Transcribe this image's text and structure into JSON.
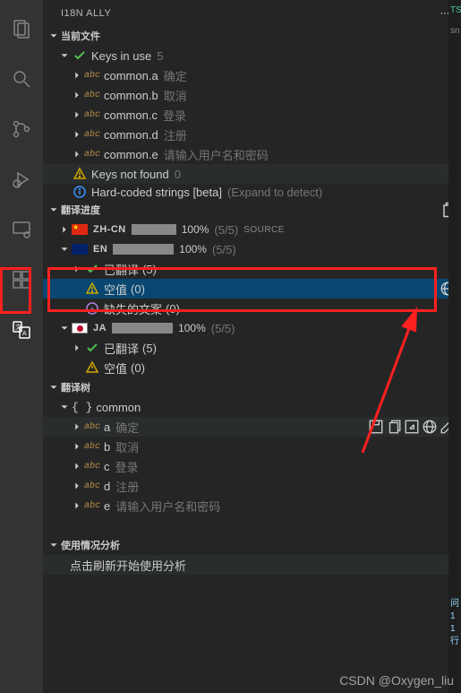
{
  "panel_title": "I18N ALLY",
  "sections": {
    "current_file": {
      "title": "当前文件",
      "keys_in_use": {
        "label": "Keys in use",
        "count": "5"
      },
      "keys": [
        {
          "key": "common.a",
          "hint": "确定"
        },
        {
          "key": "common.b",
          "hint": "取消"
        },
        {
          "key": "common.c",
          "hint": "登录"
        },
        {
          "key": "common.d",
          "hint": "注册"
        },
        {
          "key": "common.e",
          "hint": "请输入用户名和密码"
        }
      ],
      "keys_not_found": {
        "label": "Keys not found",
        "count": "0"
      },
      "hardcoded": {
        "label": "Hard-coded strings [beta]",
        "hint": "(Expand to detect)"
      }
    },
    "progress": {
      "title": "翻译进度",
      "langs": [
        {
          "code": "ZH-CN",
          "flag": "cn",
          "pct": "100%",
          "ratio": "(5/5)",
          "source": "SOURCE",
          "bar": 100
        },
        {
          "code": "EN",
          "flag": "en",
          "pct": "100%",
          "ratio": "(5/5)",
          "source": "",
          "bar": 100
        },
        {
          "code": "JA",
          "flag": "jp",
          "pct": "100%",
          "ratio": "(5/5)",
          "source": "",
          "bar": 100
        }
      ],
      "translated": {
        "label": "已翻译",
        "count": "(5)"
      },
      "empty": {
        "label": "空值",
        "count": "(0)"
      },
      "missing": {
        "label": "缺失的文案",
        "count": "(0)"
      }
    },
    "tree": {
      "title": "翻译树",
      "root": "common",
      "items": [
        {
          "key": "a",
          "hint": "确定"
        },
        {
          "key": "b",
          "hint": "取消"
        },
        {
          "key": "c",
          "hint": "登录"
        },
        {
          "key": "d",
          "hint": "注册"
        },
        {
          "key": "e",
          "hint": "请输入用户名和密码"
        }
      ]
    },
    "usage": {
      "title": "使用情况分析",
      "msg": "点击刷新开始使用分析"
    }
  },
  "right": {
    "ts": "TS",
    "sn": "sn",
    "l1": "问",
    "l2": "1",
    "l3": "1",
    "l4": "行"
  },
  "watermark": "CSDN @Oxygen_liu"
}
